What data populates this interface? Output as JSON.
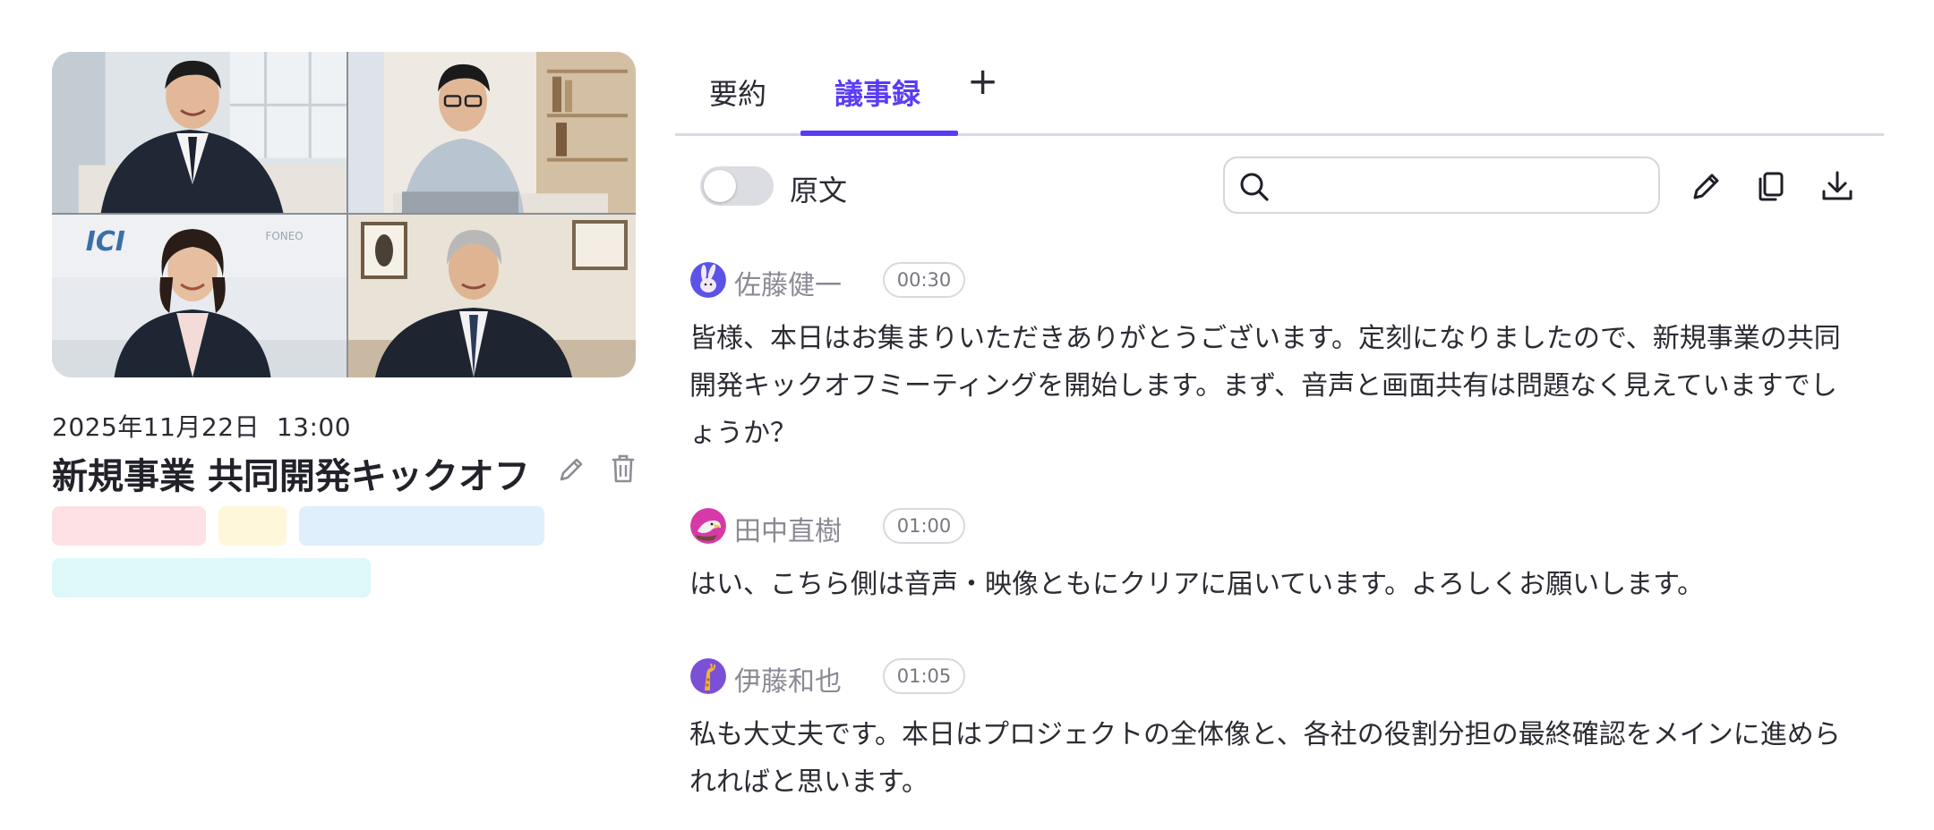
{
  "meeting": {
    "date": "2025年11月22日",
    "time": "13:00",
    "title": "新規事業 共同開発キックオフ",
    "tags": [
      {
        "color": "#fde1e5"
      },
      {
        "color": "#fff7d9"
      },
      {
        "color": "#dfeffc"
      },
      {
        "color": "#def7f9"
      }
    ],
    "video_wall_text": [
      "ICI",
      "FONEO"
    ]
  },
  "tabs": [
    {
      "label": "要約",
      "active": false
    },
    {
      "label": "議事録",
      "active": true
    }
  ],
  "tab_add_label": "+",
  "toolbar": {
    "original_text_label": "原文",
    "original_text_on": false,
    "search_placeholder": "",
    "icons": [
      "pencil-icon",
      "copy-icon",
      "download-icon"
    ]
  },
  "accent_color": "#5b3cf5",
  "transcript": [
    {
      "speaker": "佐藤健一",
      "time": "00:30",
      "text": "皆様、本日はお集まりいただきありがとうございます。定刻になりましたので、新規事業の共同開発キックオフミーティングを開始します。まず、音声と画面共有は問題なく見えていますでしょうか？",
      "avatar": "rabbit-avatar"
    },
    {
      "speaker": "田中直樹",
      "time": "01:00",
      "text": "はい、こちら側は音声・映像ともにクリアに届いています。よろしくお願いします。",
      "avatar": "eagle-avatar"
    },
    {
      "speaker": "伊藤和也",
      "time": "01:05",
      "text": "私も大丈夫です。本日はプロジェクトの全体像と、各社の役割分担の最終確認をメインに進められればと思います。",
      "avatar": "giraffe-avatar"
    }
  ]
}
